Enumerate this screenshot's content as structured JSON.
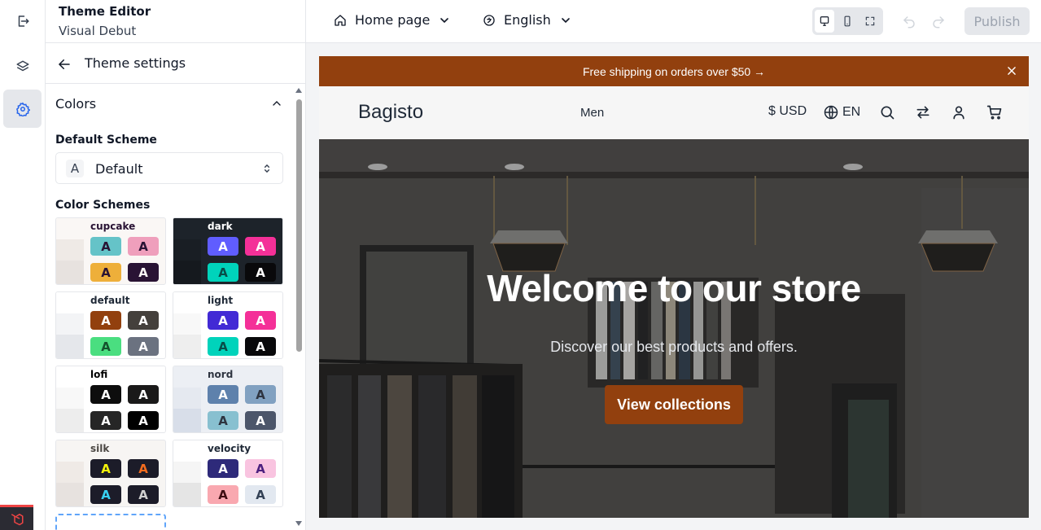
{
  "header": {
    "title": "Theme Editor",
    "subtitle": "Visual Debut",
    "page_select": "Home page",
    "language_select": "English",
    "publish_label": "Publish"
  },
  "panel": {
    "back_title": "Theme settings",
    "section_title": "Colors",
    "default_scheme_label": "Default Scheme",
    "default_scheme_letter": "A",
    "default_scheme_value": "Default",
    "color_schemes_label": "Color Schemes",
    "schemes": [
      {
        "name": "cupcake",
        "text": "#291334",
        "strips": [
          "#faf7f5",
          "#efeae6",
          "#e7e2df"
        ],
        "swatches": [
          {
            "bg": "#65c3c8",
            "fg": "#291334",
            "letter": "A"
          },
          {
            "bg": "#ef9fbc",
            "fg": "#291334",
            "letter": "A"
          },
          {
            "bg": "#eeaf3a",
            "fg": "#291334",
            "letter": "A"
          },
          {
            "bg": "#291334",
            "fg": "#faf7f5",
            "letter": "A"
          }
        ]
      },
      {
        "name": "dark",
        "text": "#ffffff",
        "strips": [
          "#1d232a",
          "#191e24",
          "#15191e"
        ],
        "swatches": [
          {
            "bg": "#605dff",
            "fg": "#ffffff",
            "letter": "A"
          },
          {
            "bg": "#f43098",
            "fg": "#ffffff",
            "letter": "A"
          },
          {
            "bg": "#00d3bb",
            "fg": "#084d49",
            "letter": "A"
          },
          {
            "bg": "#09090b",
            "fg": "#ffffff",
            "letter": "A"
          }
        ]
      },
      {
        "name": "default",
        "text": "#1f2937",
        "strips": [
          "#ffffff",
          "#f3f4f6",
          "#e5e7eb"
        ],
        "swatches": [
          {
            "bg": "#92400e",
            "fg": "#ffffff",
            "letter": "A"
          },
          {
            "bg": "#44403c",
            "fg": "#ffffff",
            "letter": "A"
          },
          {
            "bg": "#4ade80",
            "fg": "#14532d",
            "letter": "A"
          },
          {
            "bg": "#6b7280",
            "fg": "#ffffff",
            "letter": "A"
          }
        ]
      },
      {
        "name": "light",
        "text": "#1f2937",
        "strips": [
          "#ffffff",
          "#f8f8f8",
          "#eeeeee"
        ],
        "swatches": [
          {
            "bg": "#422ad5",
            "fg": "#ffffff",
            "letter": "A"
          },
          {
            "bg": "#f43098",
            "fg": "#ffffff",
            "letter": "A"
          },
          {
            "bg": "#00d3bb",
            "fg": "#084d49",
            "letter": "A"
          },
          {
            "bg": "#09090b",
            "fg": "#ffffff",
            "letter": "A"
          }
        ]
      },
      {
        "name": "lofi",
        "text": "#000000",
        "strips": [
          "#ffffff",
          "#f8f8f8",
          "#ededed"
        ],
        "swatches": [
          {
            "bg": "#0d0d0d",
            "fg": "#ffffff",
            "letter": "A"
          },
          {
            "bg": "#1a1919",
            "fg": "#ffffff",
            "letter": "A"
          },
          {
            "bg": "#262626",
            "fg": "#ffffff",
            "letter": "A"
          },
          {
            "bg": "#000000",
            "fg": "#ffffff",
            "letter": "A"
          }
        ]
      },
      {
        "name": "nord",
        "text": "#2e3440",
        "strips": [
          "#eceff4",
          "#e5e9f0",
          "#d8dee9"
        ],
        "swatches": [
          {
            "bg": "#5e81ac",
            "fg": "#ffffff",
            "letter": "A"
          },
          {
            "bg": "#81a1c1",
            "fg": "#2e3440",
            "letter": "A"
          },
          {
            "bg": "#88c0d0",
            "fg": "#2e3440",
            "letter": "A"
          },
          {
            "bg": "#4c566a",
            "fg": "#ffffff",
            "letter": "A"
          }
        ]
      },
      {
        "name": "silk",
        "text": "#4b4743",
        "strips": [
          "#f7f5f3",
          "#efeae6",
          "#e7e2df"
        ],
        "swatches": [
          {
            "bg": "#1c1c29",
            "fg": "#f5f30a",
            "letter": "A"
          },
          {
            "bg": "#1c1c29",
            "fg": "#f46c1e",
            "letter": "A"
          },
          {
            "bg": "#1c1c29",
            "fg": "#38d1f2",
            "letter": "A"
          },
          {
            "bg": "#1c1c29",
            "fg": "#d1d1d1",
            "letter": "A"
          }
        ]
      },
      {
        "name": "velocity",
        "text": "#1f2937",
        "strips": [
          "#ffffff",
          "#f5f5f5",
          "#e5e5e5"
        ],
        "swatches": [
          {
            "bg": "#2e2a7a",
            "fg": "#ffffff",
            "letter": "A"
          },
          {
            "bg": "#f9c4e0",
            "fg": "#4b1f7e",
            "letter": "A"
          },
          {
            "bg": "#f9a8b0",
            "fg": "#3f0d12",
            "letter": "A"
          },
          {
            "bg": "#e2e8f0",
            "fg": "#334155",
            "letter": "A"
          }
        ]
      }
    ]
  },
  "store": {
    "announcement": "Free shipping on orders over $50 →",
    "logo": "Bagisto",
    "nav_link": "Men",
    "currency": "$ USD",
    "language": "EN",
    "hero_title": "Welcome to our store",
    "hero_subtitle": "Discover our best products and offers.",
    "hero_button": "View collections"
  },
  "colors": {
    "accent": "#92400e",
    "active_rail": "#e5e7eb"
  }
}
